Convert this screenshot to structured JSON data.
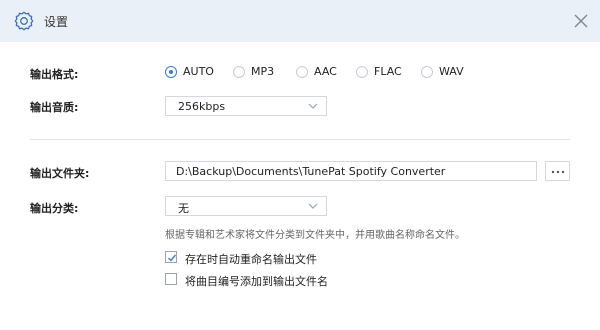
{
  "dialog": {
    "title": "设置"
  },
  "icons": {
    "title": "gear-icon",
    "close": "close-icon",
    "select_caret": "chevron-down-icon",
    "browse": "ellipsis-icon",
    "checkmark": "check-icon"
  },
  "colors": {
    "titlebar_bg": "#eaf0f7",
    "accent": "#3a7bd5"
  },
  "output_format": {
    "label": "输出格式:",
    "options": [
      "AUTO",
      "MP3",
      "AAC",
      "FLAC",
      "WAV"
    ],
    "selected": "AUTO"
  },
  "output_quality": {
    "label": "输出音质:",
    "value": "256kbps"
  },
  "output_folder": {
    "label": "输出文件夹:",
    "path": "D:\\Backup\\Documents\\TunePat Spotify Converter",
    "browse_label": "..."
  },
  "output_organize": {
    "label": "输出分类:",
    "value": "无",
    "hint": "根据专辑和艺术家将文件分类到文件夹中，并用歌曲名称命名文件。"
  },
  "checkboxes": [
    {
      "label": "存在时自动重命名输出文件",
      "checked": true
    },
    {
      "label": "将曲目编号添加到输出文件名",
      "checked": false
    }
  ]
}
